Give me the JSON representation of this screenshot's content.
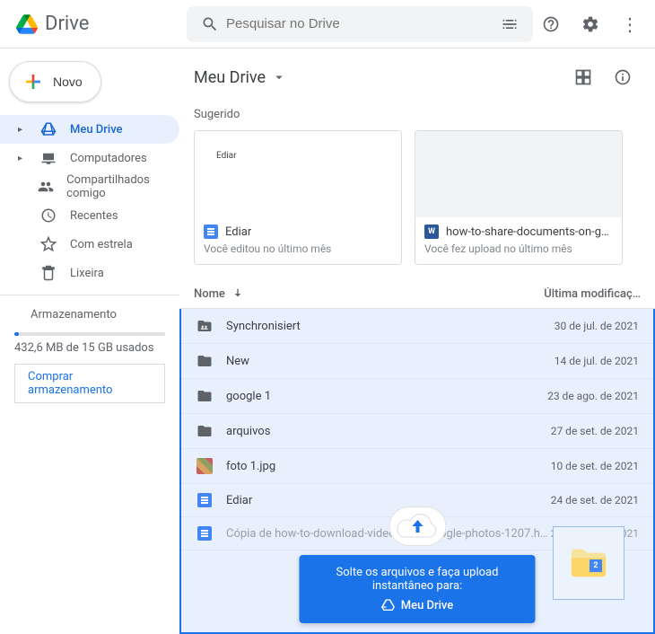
{
  "header": {
    "app_name": "Drive",
    "search_placeholder": "Pesquisar no Drive"
  },
  "sidebar": {
    "new_label": "Novo",
    "items": [
      {
        "label": "Meu Drive",
        "expandable": true,
        "active": true
      },
      {
        "label": "Computadores",
        "expandable": true
      },
      {
        "label": "Compartilhados comigo"
      },
      {
        "label": "Recentes"
      },
      {
        "label": "Com estrela"
      },
      {
        "label": "Lixeira"
      }
    ],
    "storage_label": "Armazenamento",
    "storage_used": "432,6 MB de 15 GB usados",
    "buy_label": "Comprar armazenamento"
  },
  "main": {
    "path": "Meu Drive",
    "suggested_label": "Sugerido",
    "suggested": [
      {
        "title": "Ediar",
        "thumb_text": "Ediar",
        "subtitle": "Você editou no último mês",
        "kind": "gdoc"
      },
      {
        "title": "how-to-share-documents-on-google-…",
        "thumb_text": "",
        "subtitle": "Você fez upload no último mês",
        "kind": "word"
      }
    ],
    "columns": {
      "name": "Nome",
      "modified": "Última modificaç…"
    },
    "files": [
      {
        "name": "Synchronisiert",
        "date": "30 de jul. de 2021",
        "type": "shared-folder"
      },
      {
        "name": "New",
        "date": "14 de jul. de 2021",
        "type": "folder"
      },
      {
        "name": "google 1",
        "date": "23 de ago. de 2021",
        "type": "folder"
      },
      {
        "name": "arquivos",
        "date": "27 de set. de 2021",
        "type": "folder"
      },
      {
        "name": "foto 1.jpg",
        "date": "10 de set. de 2021",
        "type": "image"
      },
      {
        "name": "Ediar",
        "date": "24 de set. de 2021",
        "type": "gdoc"
      },
      {
        "name": "Cópia de how-to-download-video-from-google-photos-1207.html",
        "date": "24 de set. de 2021",
        "type": "gdoc",
        "dimmed": true
      }
    ],
    "drop": {
      "line1": "Solte os arquivos e faça upload instantâneo para:",
      "target": "Meu Drive",
      "badge": "2"
    }
  }
}
